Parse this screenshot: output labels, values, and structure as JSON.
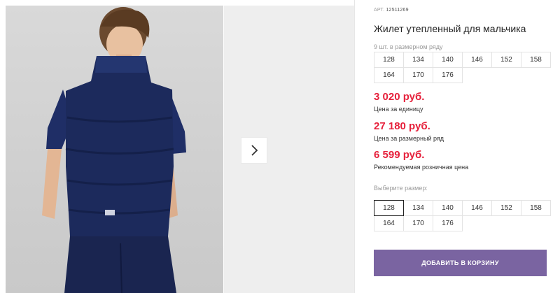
{
  "product": {
    "sku_label": "АРТ.",
    "sku_value": "12511269",
    "title": "Жилет утепленный для мальчика",
    "series_label": "9 шт. в размерном ряду",
    "series_sizes": [
      "128",
      "134",
      "140",
      "146",
      "152",
      "158",
      "164",
      "170",
      "176"
    ]
  },
  "prices": [
    {
      "value": "3 020 руб.",
      "note": "Цена за единицу"
    },
    {
      "value": "27 180 руб.",
      "note": "Цена за размерный ряд"
    },
    {
      "value": "6 599 руб.",
      "note": "Рекомендуемая розничная цена"
    }
  ],
  "size_picker": {
    "label": "Выберите размер:",
    "sizes": [
      "128",
      "134",
      "140",
      "146",
      "152",
      "158",
      "164",
      "170",
      "176"
    ],
    "selected": "128"
  },
  "cart": {
    "add_label": "ДОБАВИТЬ В КОРЗИНУ"
  },
  "gallery": {
    "next_icon": "chevron-right-icon"
  },
  "colors": {
    "accent": "#7a64a1",
    "price": "#e6203b",
    "vest": "#1c2a5c"
  }
}
